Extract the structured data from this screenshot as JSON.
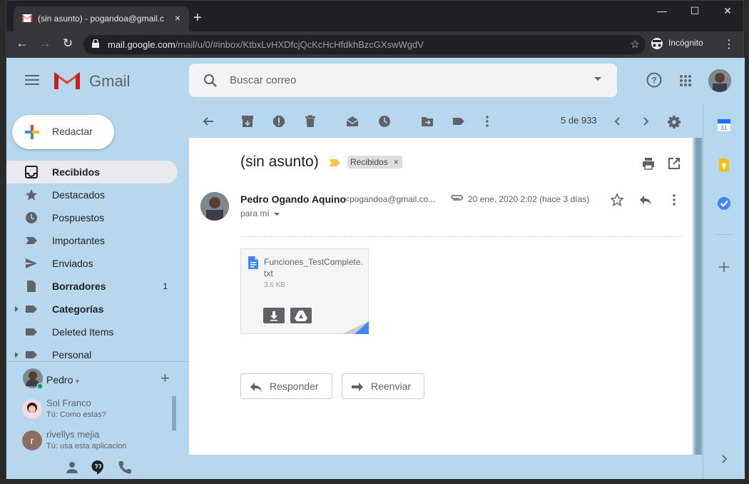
{
  "browser": {
    "tab_title": "(sin asunto) - pogandoa@gmail.c",
    "tab_close": "×",
    "new_tab": "+",
    "url_host": "mail.google.com",
    "url_path": "/mail/u/0/#inbox/KtbxLvHXDfcjQcKcHcHfdkhBzcGXswWgdV",
    "incognito_label": "Incógnito",
    "min": "—",
    "max": "☐",
    "close": "✕"
  },
  "app": {
    "name": "Gmail",
    "search_placeholder": "Buscar correo",
    "compose_label": "Redactar"
  },
  "sidebar": {
    "items": [
      {
        "label": "Recibidos",
        "icon": "inbox-icon",
        "active": true,
        "bold": true,
        "count": ""
      },
      {
        "label": "Destacados",
        "icon": "star-icon",
        "count": ""
      },
      {
        "label": "Pospuestos",
        "icon": "clock-icon",
        "count": ""
      },
      {
        "label": "Importantes",
        "icon": "important-icon",
        "count": ""
      },
      {
        "label": "Enviados",
        "icon": "send-icon",
        "count": ""
      },
      {
        "label": "Borradores",
        "icon": "draft-icon",
        "bold": true,
        "count": "1"
      },
      {
        "label": "Categorías",
        "icon": "label-icon",
        "bold": true,
        "expandable": true,
        "count": ""
      },
      {
        "label": "Deleted Items",
        "icon": "label-icon",
        "count": ""
      },
      {
        "label": "Personal",
        "icon": "label-icon",
        "expandable": true,
        "count": ""
      }
    ]
  },
  "hangouts": {
    "user_name": "Pedro",
    "chats": [
      {
        "name": "Sol Franco",
        "message": "Tú: Como estas?"
      },
      {
        "name": "rivellys mejia",
        "message": "Tú: usa esta aplicacion",
        "initial": "r"
      }
    ]
  },
  "toolbar": {
    "pager": "5 de 933"
  },
  "message": {
    "subject": "(sin asunto)",
    "label": "Recibidos",
    "label_remove": "×",
    "sender_name": "Pedro Ogando Aquino",
    "sender_email": "<pogandoa@gmail.co...",
    "recipient": "para mí",
    "date": "20 ene. 2020 2:02 (hace 3 días)",
    "attachment": {
      "filename": "Funciones_TestComplete.txt",
      "size": "3.6 KB"
    },
    "reply_label": "Responder",
    "forward_label": "Reenviar"
  },
  "colors": {
    "theme_bg": "#b6d7ed",
    "gmail_red": "#ea4335",
    "calendar_blue": "#1a73e8",
    "keep_yellow": "#fbbc04",
    "tasks_blue": "#4285f4"
  }
}
